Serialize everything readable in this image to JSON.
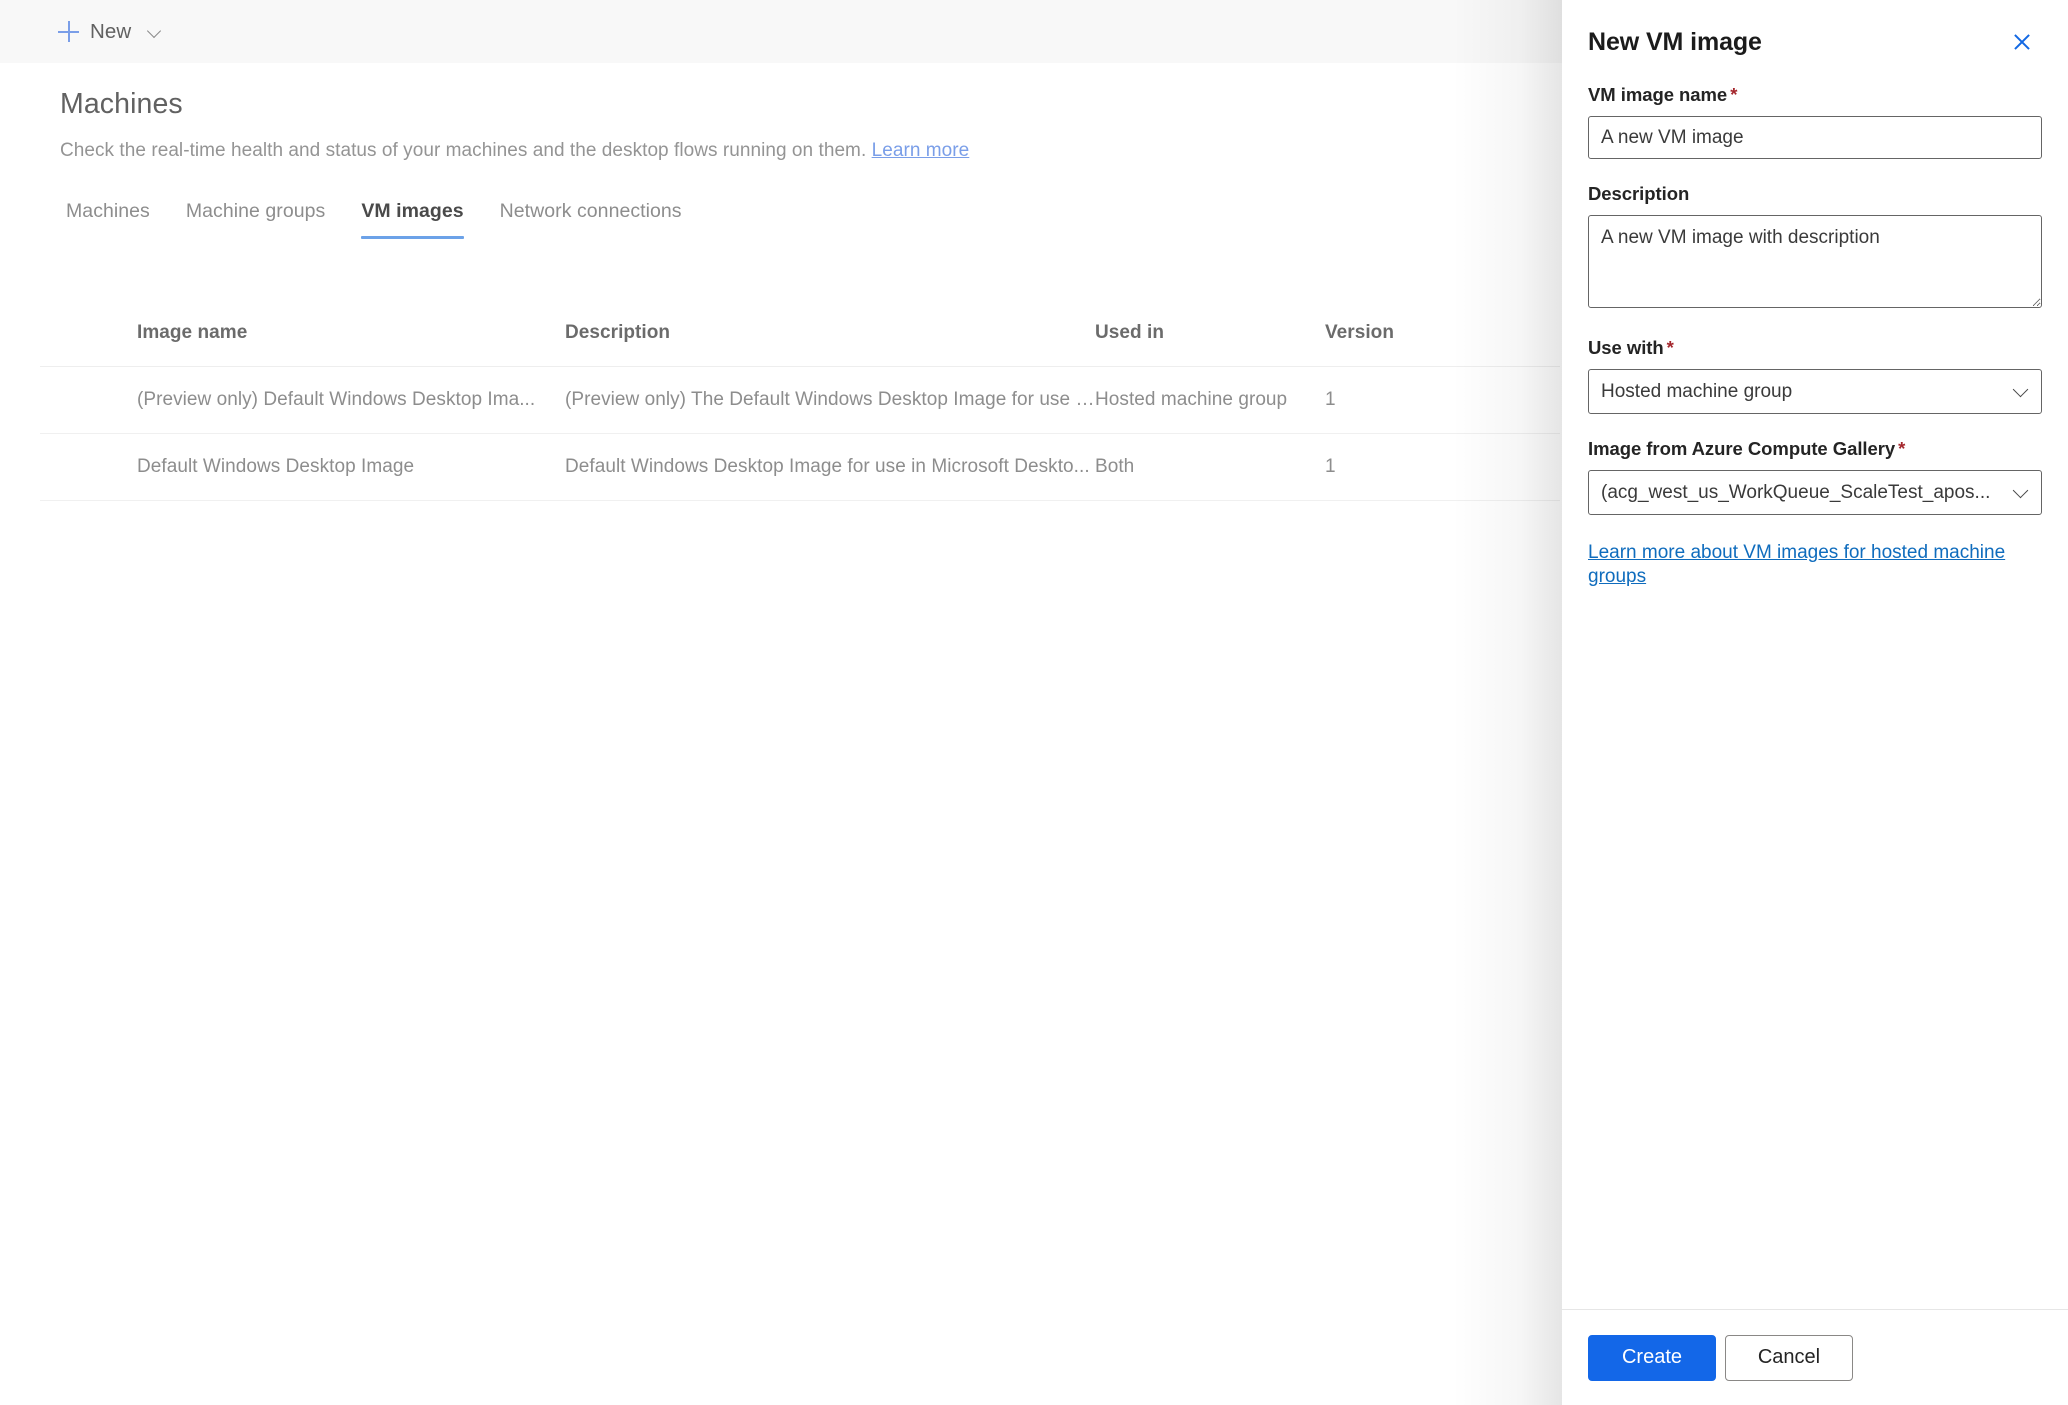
{
  "command_bar": {
    "new_label": "New",
    "plus_icon": "plus-icon",
    "chevron_icon": "chevron-down-icon"
  },
  "page": {
    "title": "Machines",
    "subtitle": "Check the real-time health and status of your machines and the desktop flows running on them.",
    "learn_more": "Learn more"
  },
  "tabs": [
    {
      "label": "Machines",
      "active": false
    },
    {
      "label": "Machine groups",
      "active": false
    },
    {
      "label": "VM images",
      "active": true
    },
    {
      "label": "Network connections",
      "active": false
    }
  ],
  "table": {
    "columns": [
      "Image name",
      "Description",
      "Used in",
      "Version"
    ],
    "rows": [
      {
        "image_name": "(Preview only) Default Windows Desktop Ima...",
        "description": "(Preview only) The Default Windows Desktop Image for use i...",
        "used_in": "Hosted machine group",
        "version": "1"
      },
      {
        "image_name": "Default Windows Desktop Image",
        "description": "Default Windows Desktop Image for use in Microsoft Deskto...",
        "used_in": "Both",
        "version": "1"
      }
    ]
  },
  "panel": {
    "title": "New VM image",
    "close_icon": "close-icon",
    "fields": {
      "vm_image_name": {
        "label": "VM image name",
        "required_marker": "*",
        "value": "A new VM image",
        "placeholder": "VM image name"
      },
      "description": {
        "label": "Description",
        "required_marker": "",
        "value": "A new VM image with description",
        "placeholder": "Description"
      },
      "use_with": {
        "label": "Use with",
        "required_marker": "*",
        "value": "Hosted machine group",
        "chevron_icon": "chevron-down-icon"
      },
      "image_gallery": {
        "label": "Image from Azure Compute Gallery",
        "required_marker": "*",
        "value": "(acg_west_us_WorkQueue_ScaleTest_apos...",
        "chevron_icon": "chevron-down-icon"
      }
    },
    "link": "Learn more about VM images for hosted machine groups",
    "buttons": {
      "create": "Create",
      "cancel": "Cancel"
    }
  },
  "colors": {
    "accent_blue": "#1367e8",
    "link_blue": "#0f6cbd",
    "tab_underline": "#6ca2e8",
    "required_red": "#a4262c",
    "command_bar_bg": "#f8f8f8"
  }
}
